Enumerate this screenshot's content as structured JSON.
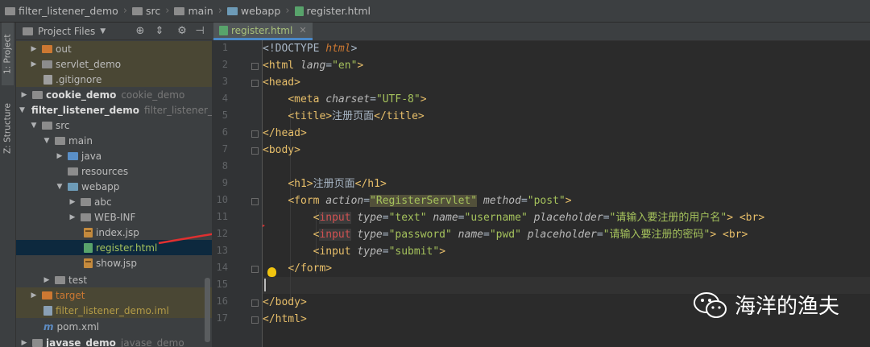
{
  "breadcrumb": {
    "items": [
      "filter_listener_demo",
      "src",
      "main",
      "webapp",
      "register.html"
    ]
  },
  "left_strip": {
    "project_tab": "1: Project",
    "structure_tab": "Z: Structure"
  },
  "project_panel": {
    "title": "Project Files",
    "tree": [
      {
        "label": "out",
        "extra": ""
      },
      {
        "label": "servlet_demo",
        "extra": ""
      },
      {
        "label": ".gitignore",
        "extra": ""
      },
      {
        "label": "cookie_demo",
        "extra": "cookie_demo"
      },
      {
        "label": "filter_listener_demo",
        "extra": "filter_listener_demo"
      },
      {
        "label": "src",
        "extra": ""
      },
      {
        "label": "main",
        "extra": ""
      },
      {
        "label": "java",
        "extra": ""
      },
      {
        "label": "resources",
        "extra": ""
      },
      {
        "label": "webapp",
        "extra": ""
      },
      {
        "label": "abc",
        "extra": ""
      },
      {
        "label": "WEB-INF",
        "extra": ""
      },
      {
        "label": "index.jsp",
        "extra": ""
      },
      {
        "label": "register.html",
        "extra": ""
      },
      {
        "label": "show.jsp",
        "extra": ""
      },
      {
        "label": "test",
        "extra": ""
      },
      {
        "label": "target",
        "extra": ""
      },
      {
        "label": "filter_listener_demo.iml",
        "extra": ""
      },
      {
        "label": "pom.xml",
        "extra": ""
      },
      {
        "label": "javase_demo",
        "extra": "javase_demo"
      }
    ]
  },
  "editor": {
    "active_tab": "register.html",
    "line_numbers": [
      "1",
      "2",
      "3",
      "4",
      "5",
      "6",
      "7",
      "8",
      "9",
      "10",
      "11",
      "12",
      "13",
      "14",
      "15",
      "16",
      "17"
    ],
    "code": {
      "l1_doctype": "<!DOCTYPE ",
      "l1_html": "html",
      "l1_end": ">",
      "l2_lang_val": "\"en\"",
      "l4_charset_val": "\"UTF-8\"",
      "l5_title_text": "注册页面",
      "l9_h1_text": "注册页面",
      "l10_action_val": "\"RegisterServlet\"",
      "l10_method_val": "\"post\"",
      "l11_type_val": "\"text\"",
      "l11_name_val": "\"username\"",
      "l11_placeholder_val": "\"请输入要注册的用户名\"",
      "l12_type_val": "\"password\"",
      "l12_name_val": "\"pwd\"",
      "l12_placeholder_val": "\"请输入要注册的密码\"",
      "l13_type_val": "\"submit\""
    }
  },
  "watermark": {
    "text": "海洋的渔夫"
  },
  "colors": {
    "editor_bg": "#2b2b2b",
    "panel_bg": "#3c3f41",
    "tag": "#e8bf6a",
    "attr_value": "#a5c25c",
    "keyword": "#cc7832",
    "selection": "#0d293e",
    "arrow": "#e03030"
  }
}
